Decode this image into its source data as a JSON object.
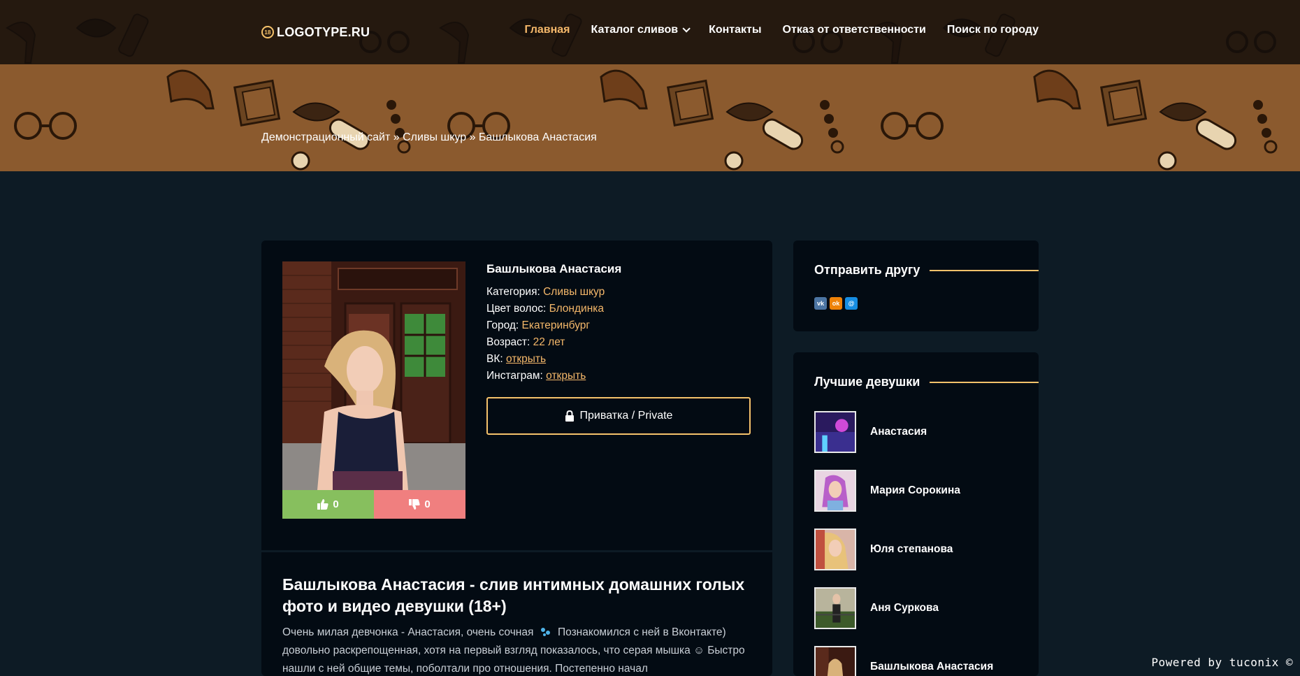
{
  "header": {
    "logo_text": "LOGOTYPE.RU",
    "logo_badge": "18",
    "nav": [
      {
        "label": "Главная",
        "active": true
      },
      {
        "label": "Каталог сливов",
        "active": false,
        "dropdown": true
      },
      {
        "label": "Контакты",
        "active": false
      },
      {
        "label": "Отказ от ответственности",
        "active": false
      },
      {
        "label": "Поиск по городу",
        "active": false
      }
    ]
  },
  "breadcrumb": {
    "items": [
      "Демонстрационный сайт",
      "Сливы шкур",
      "Башлыкова Анастасия"
    ],
    "sep": " » "
  },
  "profile": {
    "name": "Башлыкова Анастасия",
    "category_label": "Категория:",
    "category_value": "Сливы шкур",
    "hair_label": "Цвет волос:",
    "hair_value": "Блондинка",
    "city_label": "Город:",
    "city_value": "Екатеринбург",
    "age_label": "Возраст:",
    "age_value": "22 лет",
    "vk_label": "ВК:",
    "vk_link": "открыть",
    "insta_label": "Инстаграм:",
    "insta_link": "открыть",
    "private_button": "Приватка / Private",
    "likes": "0",
    "dislikes": "0"
  },
  "article": {
    "title": "Башлыкова Анастасия - слив интимных домашних голых фото и видео девушки (18+)",
    "text_1": "Очень милая девчонка - Анастасия, очень сочная",
    "text_2": "Познакомился с ней в Вконтакте) довольно раскрепощенная, хотя на первый взгляд показалось, что серая мышка ☺ Быстро нашли с ней общие темы, поболтали про отношения. Постепенно начал"
  },
  "sidebar": {
    "share_title": "Отправить другу",
    "share_icons": [
      "vk-icon",
      "ok-icon",
      "mail-icon"
    ],
    "best_title": "Лучшие девушки",
    "girls": [
      {
        "name": "Анастасия"
      },
      {
        "name": "Мария Сорокина"
      },
      {
        "name": "Юля степанова"
      },
      {
        "name": "Аня Суркова"
      },
      {
        "name": "Башлыкова Анастасия"
      }
    ]
  },
  "footer": {
    "powered": "Powered by tuconix ©"
  },
  "colors": {
    "accent": "#f5b86a",
    "background": "#0d1b25",
    "card": "#030b13",
    "like": "#87bf5e",
    "dislike": "#f07f7f"
  }
}
